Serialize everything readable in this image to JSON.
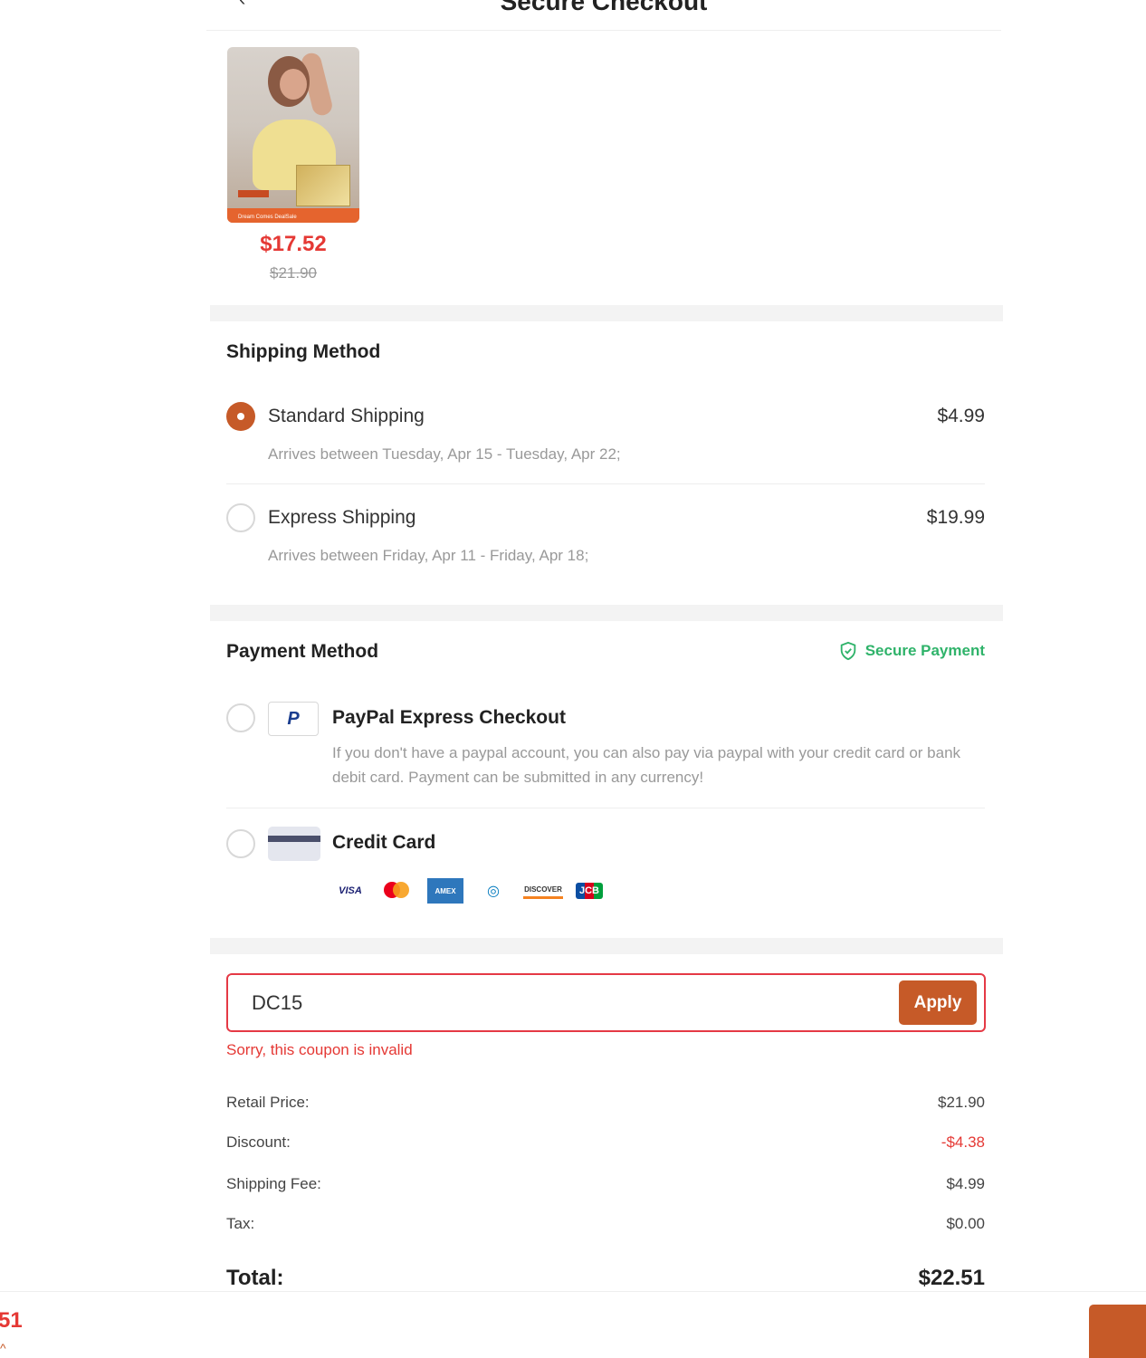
{
  "header": {
    "back_icon": "chevron-left-icon",
    "title": "Secure Checkout"
  },
  "product": {
    "image_alt": "product-image",
    "banner_text": "Dream Comes DealSale",
    "price": "$17.52",
    "original_price": "$21.90"
  },
  "shipping": {
    "title": "Shipping Method",
    "options": [
      {
        "name": "Standard Shipping",
        "price": "$4.99",
        "eta": "Arrives between Tuesday, Apr 15 - Tuesday, Apr 22;",
        "selected": true
      },
      {
        "name": "Express Shipping",
        "price": "$19.99",
        "eta": "Arrives between Friday, Apr 11 - Friday, Apr 18;",
        "selected": false
      }
    ]
  },
  "payment": {
    "title": "Payment Method",
    "secure_label": "Secure Payment",
    "secure_icon": "shield-check-icon",
    "secure_color": "#2fb36a",
    "options": [
      {
        "name": "PayPal Express Checkout",
        "description": "If you don't have a paypal account, you can also pay via paypal with your credit card or bank debit card. Payment can be submitted in any currency!",
        "icon": "paypal-icon",
        "logo_text": "P"
      },
      {
        "name": "Credit Card",
        "icon": "credit-card-icon"
      }
    ],
    "card_brands": {
      "visa": "VISA",
      "amex": "AMEX",
      "diners": "◎",
      "discover": "DISCOVER",
      "jcb": "JCB"
    }
  },
  "coupon": {
    "value": "DC15",
    "apply_label": "Apply",
    "error": "Sorry, this coupon is invalid",
    "error_color": "#e53935"
  },
  "summary": {
    "retail_label": "Retail Price:",
    "retail_value": "$21.90",
    "discount_label": "Discount:",
    "discount_value": "-$4.38",
    "shipping_label": "Shipping Fee:",
    "shipping_value": "$4.99",
    "tax_label": "Tax:",
    "tax_value": "$0.00",
    "total_label": "Total:",
    "total_value": "$22.51"
  },
  "bottom_bar": {
    "total_fragment": "51",
    "caret": "^",
    "accent_color": "#c65a28"
  }
}
